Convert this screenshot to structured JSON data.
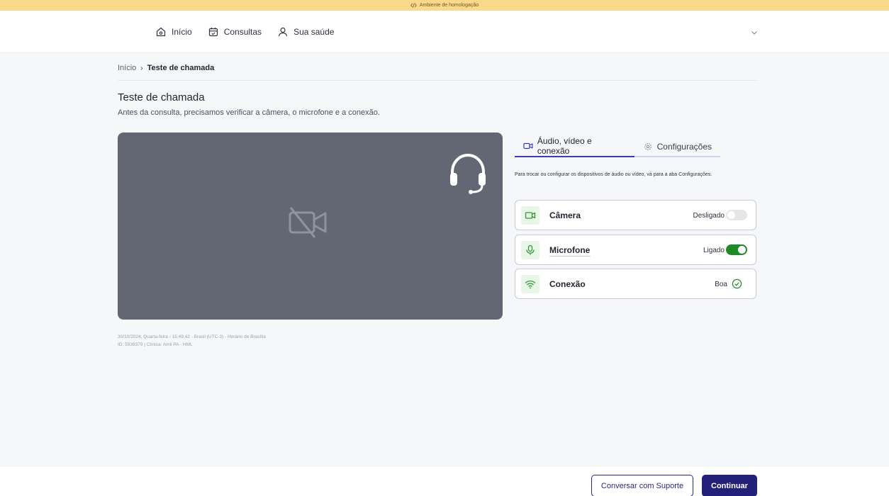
{
  "banner": {
    "text": "Ambiente de homologação",
    "icon": "code-icon",
    "bg": "#fbd98a"
  },
  "nav": {
    "items": [
      {
        "label": "Início",
        "icon": "home-icon"
      },
      {
        "label": "Consultas",
        "icon": "calendar-icon"
      },
      {
        "label": "Sua saúde",
        "icon": "user-icon"
      }
    ],
    "menu_icon": "chevron-down-icon"
  },
  "breadcrumb": {
    "home": "Início",
    "separator": "›",
    "current": "Teste de chamada"
  },
  "page": {
    "title": "Teste de chamada",
    "subtitle": "Antes da consulta, precisamos verificar a câmera, o microfone e a conexão."
  },
  "video": {
    "icons": [
      "camera-off-icon",
      "headset-icon"
    ],
    "bg": "#636773"
  },
  "meta": {
    "line1": "30/10/2024, Quarta-feira - 15:49:42 - Brasil (UTC-3) - Horário de Brasília",
    "line2": "ID: 5939379 | Clínica: Amil PA - HML"
  },
  "tabs": [
    {
      "label": "Áudio, vídeo e conexão",
      "icon": "video-icon",
      "active": true
    },
    {
      "label": "Configurações",
      "icon": "gear-icon",
      "active": false
    }
  ],
  "hint": "Para trocar ou configurar os dispositivos de áudio ou vídeo, vá para a aba Configurações.",
  "devices": {
    "camera": {
      "label": "Câmera",
      "status": "Desligado",
      "enabled": false,
      "icon": "video-icon"
    },
    "microphone": {
      "label": "Microfone",
      "status": "Ligado",
      "enabled": true,
      "icon": "microphone-icon"
    },
    "connection": {
      "label": "Conexão",
      "status": "Boa",
      "icon": "wifi-icon",
      "status_icon": "check-circle-icon"
    }
  },
  "footer": {
    "support_button": "Conversar com Suporte",
    "continue_button": "Continuar"
  },
  "colors": {
    "accent": "#23207a",
    "success": "#1f8a25",
    "tab_active": "#3d3bb7"
  }
}
